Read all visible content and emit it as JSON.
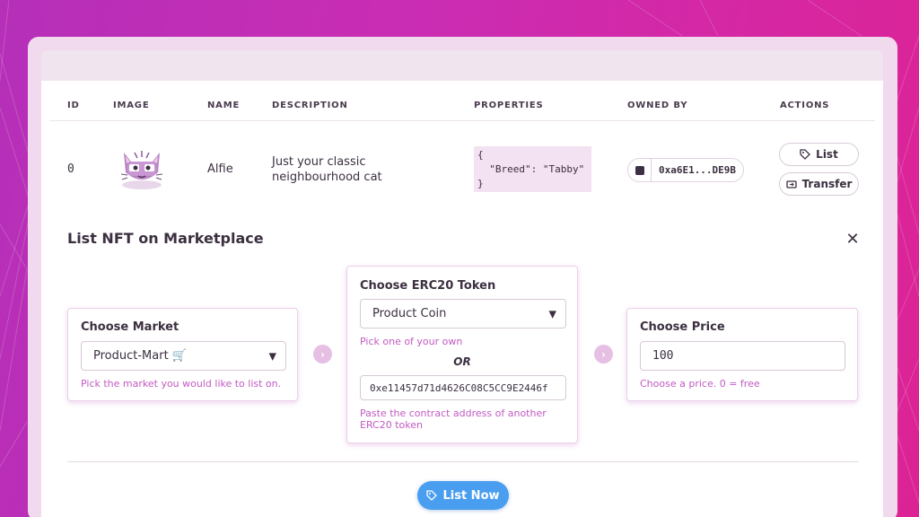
{
  "table": {
    "headers": [
      "ID",
      "IMAGE",
      "NAME",
      "DESCRIPTION",
      "PROPERTIES",
      "OWNED BY",
      "ACTIONS"
    ],
    "row": {
      "id": "0",
      "name": "Alfie",
      "description_line1": "Just your classic",
      "description_line2": "neighbourhood cat",
      "properties_open": "{",
      "properties_line": "  \"Breed\": \"Tabby\"",
      "properties_close": "}",
      "owner": "0xa6E1...DE9B",
      "list_label": "List",
      "transfer_label": "Transfer"
    }
  },
  "listing": {
    "title": "List NFT on Marketplace",
    "market": {
      "title": "Choose Market",
      "value": "Product-Mart 🛒",
      "hint": "Pick the market you would like to list on."
    },
    "token": {
      "title": "Choose ERC20 Token",
      "value": "Product Coin",
      "hint": "Pick one of your own",
      "or": "OR",
      "address": "0xe11457d71d4626C08C5CC9E2446f",
      "address_hint_line1": "Paste the contract address of another",
      "address_hint_line2": "ERC20 token"
    },
    "price": {
      "title": "Choose Price",
      "value": "100",
      "hint": "Choose a price. 0 = free"
    },
    "submit_label": "List Now"
  },
  "colors": {
    "accent": "#c25ac2",
    "primary_button": "#4a9ef0",
    "background": "#c92db4"
  }
}
